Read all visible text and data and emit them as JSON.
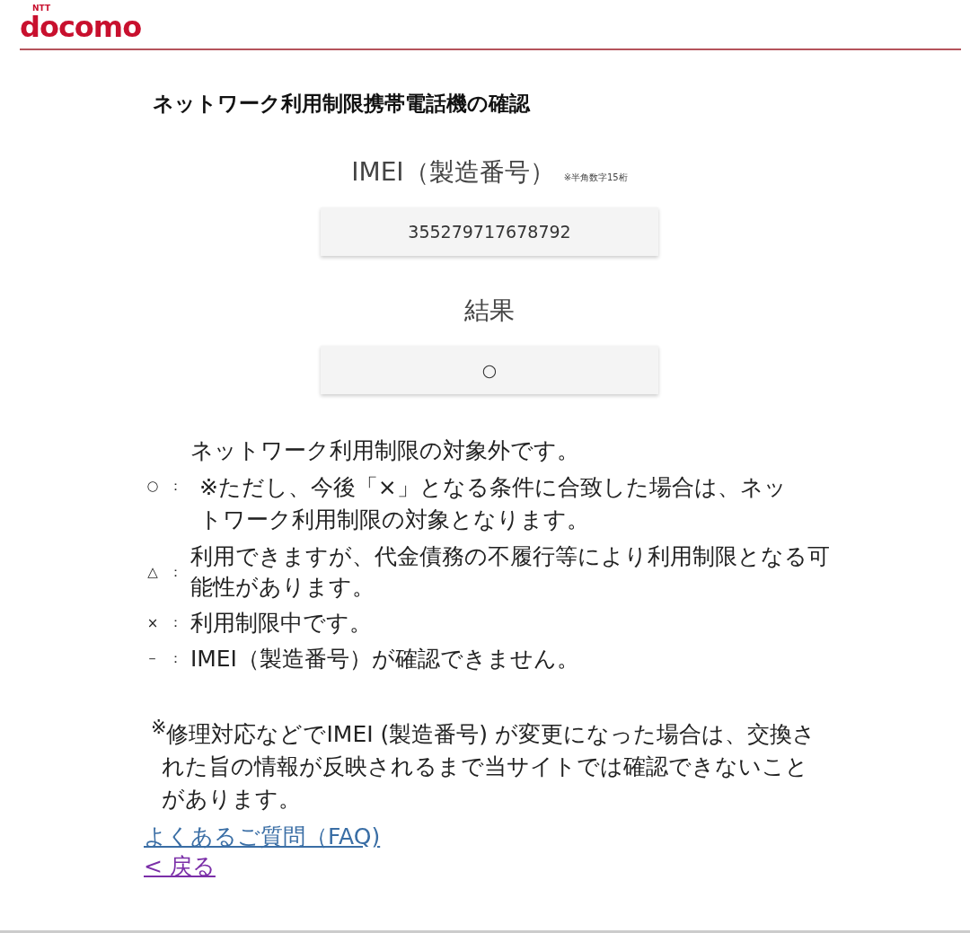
{
  "header": {
    "logo_small": "NTT",
    "logo": "docomo"
  },
  "title": "ネットワーク利用制限携帯電話機の確認",
  "imei": {
    "label": "IMEI（製造番号）",
    "hint": "※半角数字15桁",
    "value": "355279717678792"
  },
  "result": {
    "label": "結果",
    "value": "○"
  },
  "legend": [
    {
      "symbol": "○",
      "separator": "：",
      "text": "ネットワーク利用制限の対象外です。",
      "note": "※ただし、今後「×」となる条件に合致した場合は、ネットワーク利用制限の対象となります。"
    },
    {
      "symbol": "△",
      "separator": "：",
      "text": "利用できますが、代金債務の不履行等により利用制限となる可能性があります。"
    },
    {
      "symbol": "×",
      "separator": "：",
      "text": "利用制限中です。"
    },
    {
      "symbol": "－",
      "separator": "：",
      "text": "IMEI（製造番号）が確認できません。"
    }
  ],
  "footnote": "$^{※}$修理対応などでIMEI (製造番号) が変更になった場合は、交換された旨の情報が反映されるまで当サイトでは確認できないことがあります。",
  "links": [
    {
      "label": "よくあるご質問（FAQ)",
      "visited": false
    },
    {
      "label": "< 戻る",
      "visited": true
    }
  ]
}
